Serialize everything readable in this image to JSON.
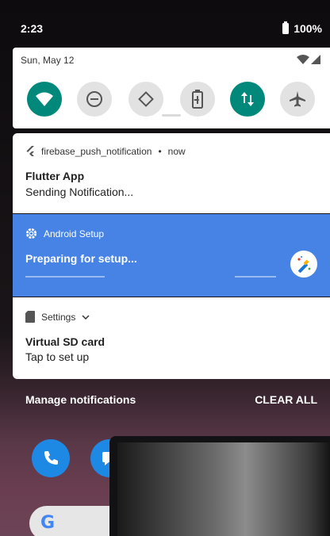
{
  "status_bar": {
    "time": "2:23",
    "battery": "100%"
  },
  "quick_settings": {
    "date": "Sun, May 12",
    "tiles": [
      {
        "name": "wifi",
        "state": "on",
        "icon": "wifi-icon"
      },
      {
        "name": "do-not-disturb",
        "state": "off",
        "icon": "do-not-disturb-icon"
      },
      {
        "name": "auto-rotate",
        "state": "off",
        "icon": "auto-rotate-icon"
      },
      {
        "name": "battery-saver",
        "state": "off",
        "icon": "battery-saver-icon"
      },
      {
        "name": "mobile-data",
        "state": "on",
        "icon": "mobile-data-icon"
      },
      {
        "name": "airplane-mode",
        "state": "off",
        "icon": "airplane-icon"
      }
    ]
  },
  "notifications": [
    {
      "app": "firebase_push_notification",
      "time": "now",
      "title": "Flutter App",
      "text": "Sending Notification...",
      "icon": "flutter-icon"
    },
    {
      "app": "Android Setup",
      "title": "Preparing for setup...",
      "icon": "gear-icon",
      "large_icon": "magic-wand-icon",
      "color": "#4683e4"
    },
    {
      "app": "Settings",
      "title": "Virtual SD card",
      "text": "Tap to set up",
      "icon": "sd-card-icon"
    }
  ],
  "footer": {
    "manage": "Manage notifications",
    "clear_all": "CLEAR ALL"
  },
  "colors": {
    "accent_teal": "#00897b",
    "setup_blue": "#4683e4",
    "tile_off": "#e2e2e2"
  },
  "home": {
    "search_logo": "G"
  }
}
